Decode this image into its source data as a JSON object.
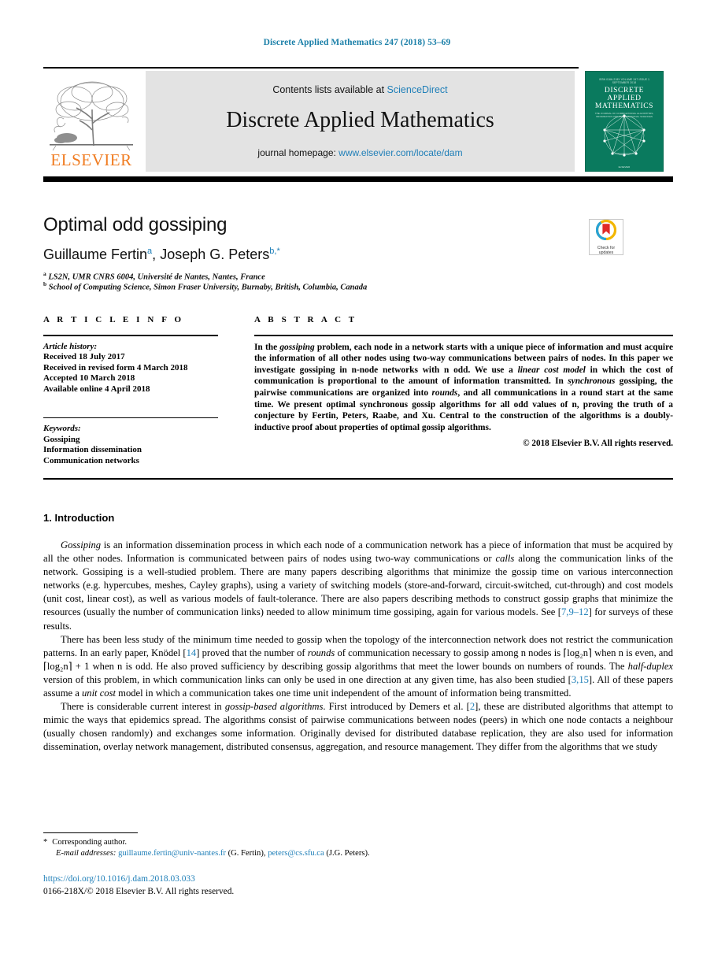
{
  "running_head": "Discrete Applied Mathematics 247 (2018) 53–69",
  "masthead": {
    "publisher_name": "ELSEVIER",
    "contents_prefix": "Contents lists available at",
    "contents_link": "ScienceDirect",
    "journal_name": "Discrete Applied Mathematics",
    "homepage_prefix": "journal homepage:",
    "homepage_url": "www.elsevier.com/locate/dam",
    "cover": {
      "top_line": "ISSN 0166-218X   VOLUME 247   ISSUE 1   SEPTEMBER 2018",
      "line1": "DISCRETE",
      "line2": "APPLIED",
      "line3": "MATHEMATICS",
      "subtitle": "THE JOURNAL OF COMBINATORIAL ALGORITHMS,\nINFORMATICS AND COMPUTATIONAL SCIENCES",
      "footer": "ELSEVIER"
    }
  },
  "article": {
    "title": "Optimal odd gossiping",
    "authors_html": "Guillaume Fertin, Joseph G. Peters",
    "author1": "Guillaume Fertin",
    "author1_marker": "a",
    "author2": "Joseph G. Peters",
    "author2_marker": "b,*",
    "affiliation_a_marker": "a",
    "affiliation_a": "LS2N, UMR CNRS 6004, Université de Nantes, Nantes, France",
    "affiliation_b_marker": "b",
    "affiliation_b": "School of Computing Science, Simon Fraser University, Burnaby, British, Columbia, Canada",
    "crossmark_label": "Check for\nupdates"
  },
  "article_info": {
    "heading": "A R T I C L E   I N F O",
    "history_label": "Article history:",
    "history": [
      "Received 18 July 2017",
      "Received in revised form 4 March 2018",
      "Accepted 10 March 2018",
      "Available online 4 April 2018"
    ],
    "keywords_label": "Keywords:",
    "keywords": [
      "Gossiping",
      "Information dissemination",
      "Communication networks"
    ]
  },
  "abstract": {
    "heading": "A B S T R A C T",
    "paragraphs": [
      "In the gossiping problem, each node in a network starts with a unique piece of information and must acquire the information of all other nodes using two-way communications between pairs of nodes. In this paper we investigate gossiping in n-node networks with n odd. We use a linear cost model in which the cost of communication is proportional to the amount of information transmitted. In synchronous gossiping, the pairwise communications are organized into rounds, and all communications in a round start at the same time. We present optimal synchronous gossip algorithms for all odd values of n, proving the truth of a conjecture by Fertin, Peters, Raabe, and Xu. Central to the construction of the algorithms is a doubly-inductive proof about properties of optimal gossip algorithms."
    ],
    "copyright": "© 2018 Elsevier B.V. All rights reserved."
  },
  "body": {
    "section_number_title": "1. Introduction",
    "paragraph1": "Gossiping is an information dissemination process in which each node of a communication network has a piece of information that must be acquired by all the other nodes. Information is communicated between pairs of nodes using two-way communications or calls along the communication links of the network. Gossiping is a well-studied problem. There are many papers describing algorithms that minimize the gossip time on various interconnection networks (e.g. hypercubes, meshes, Cayley graphs), using a variety of switching models (store-and-forward, circuit-switched, cut-through) and cost models (unit cost, linear cost), as well as various models of fault-tolerance. There are also papers describing methods to construct gossip graphs that minimize the resources (usually the number of communication links) needed to allow minimum time gossiping, again for various models. See [7,9–12] for surveys of these results.",
    "paragraph2": "There has been less study of the minimum time needed to gossip when the topology of the interconnection network does not restrict the communication patterns. In an early paper, Knödel [14] proved that the number of rounds of communication necessary to gossip among n nodes is ⌈log₂n⌉ when n is even, and ⌈log₂n⌉ + 1 when n is odd. He also proved sufficiency by describing gossip algorithms that meet the lower bounds on numbers of rounds. The half-duplex version of this problem, in which communication links can only be used in one direction at any given time, has also been studied [3,15]. All of these papers assume a unit cost model in which a communication takes one time unit independent of the amount of information being transmitted.",
    "paragraph3": "There is considerable current interest in gossip-based algorithms. First introduced by Demers et al. [2], these are distributed algorithms that attempt to mimic the ways that epidemics spread. The algorithms consist of pairwise communications between nodes (peers) in which one node contacts a neighbour (usually chosen randomly) and exchanges some information. Originally devised for distributed database replication, they are also used for information dissemination, overlay network management, distributed consensus, aggregation, and resource management. They differ from the algorithms that we study",
    "citations": [
      "7,9–12",
      "14",
      "3,15",
      "2"
    ]
  },
  "footnotes": {
    "corresponding_marker": "*",
    "corresponding_text": "Corresponding author.",
    "email_label": "E-mail addresses:",
    "email1": "guillaume.fertin@univ-nantes.fr",
    "email1_owner": "(G. Fertin),",
    "email2": "peters@cs.sfu.ca",
    "email2_owner": "(J.G. Peters)."
  },
  "footer": {
    "doi": "https://doi.org/10.1016/j.dam.2018.03.033",
    "issn_line": "0166-218X/© 2018 Elsevier B.V. All rights reserved."
  },
  "colors": {
    "link_blue": "#1f7fb8",
    "running_head_blue": "#1a7fa8",
    "elsevier_orange": "#F07C21",
    "cover_green": "#0a7a5e",
    "band_grey": "#e3e3e3"
  }
}
